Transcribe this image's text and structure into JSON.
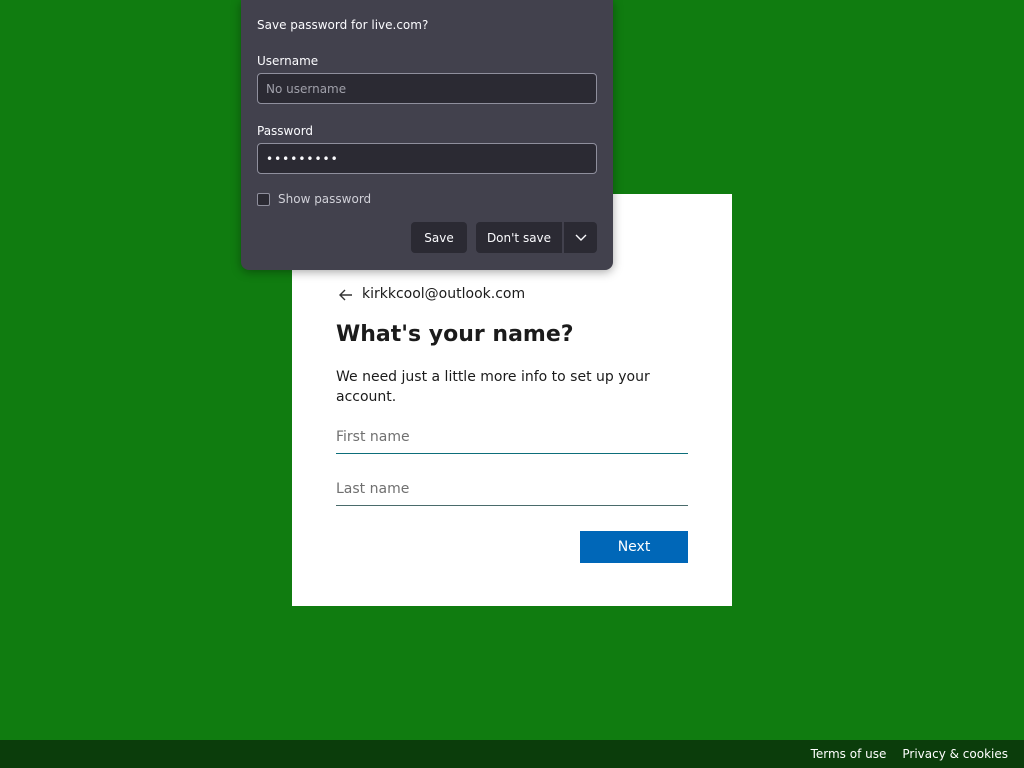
{
  "signin": {
    "identity": "kirkkcool@outlook.com",
    "title": "What's your name?",
    "description": "We need just a little more info to set up your account.",
    "first_name_placeholder": "First name",
    "last_name_placeholder": "Last name",
    "next_label": "Next"
  },
  "password_popup": {
    "title": "Save password for live.com?",
    "username_label": "Username",
    "username_placeholder": "No username",
    "password_label": "Password",
    "password_value": "•••••••••",
    "show_password_label": "Show password",
    "show_password_checked": false,
    "save_label": "Save",
    "dont_save_label": "Don't save"
  },
  "footer": {
    "terms_label": "Terms of use",
    "privacy_label": "Privacy & cookies"
  },
  "colors": {
    "background": "#107c10",
    "footer_background": "#0b3d0b",
    "accent_button": "#0067b8",
    "popup_background": "#42414d"
  },
  "icons": {
    "back": "back-arrow-icon",
    "dropdown": "chevron-down-icon"
  }
}
